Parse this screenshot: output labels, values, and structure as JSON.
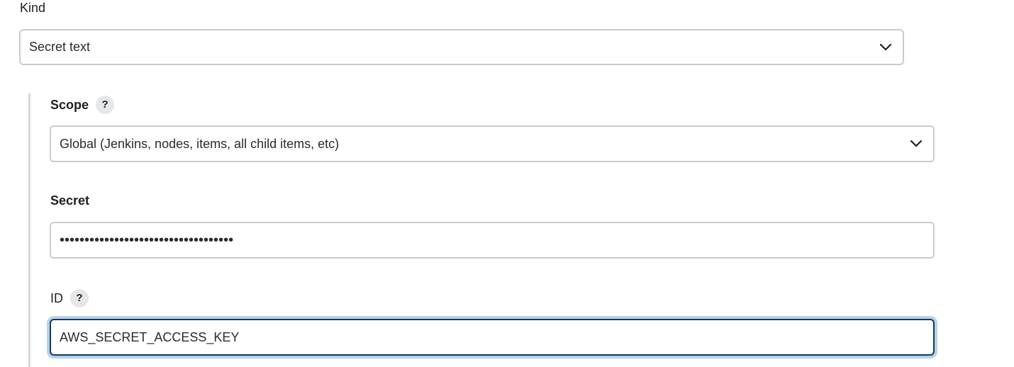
{
  "kind": {
    "label": "Kind",
    "selected": "Secret text"
  },
  "scope": {
    "label": "Scope",
    "help": "?",
    "selected": "Global (Jenkins, nodes, items, all child items, etc)"
  },
  "secret": {
    "label": "Secret",
    "value_masked": "•••••••••••••••••••••••••••••••••••"
  },
  "id": {
    "label": "ID",
    "help": "?",
    "value": "AWS_SECRET_ACCESS_KEY"
  },
  "icons": {
    "dropdown": "chevron-down-icon",
    "help": "help-icon"
  },
  "colors": {
    "border": "#c8ccd0",
    "focus_border": "#0d3b66",
    "focus_ring": "#b9d3e4",
    "help_bg": "#e6e7e9"
  }
}
